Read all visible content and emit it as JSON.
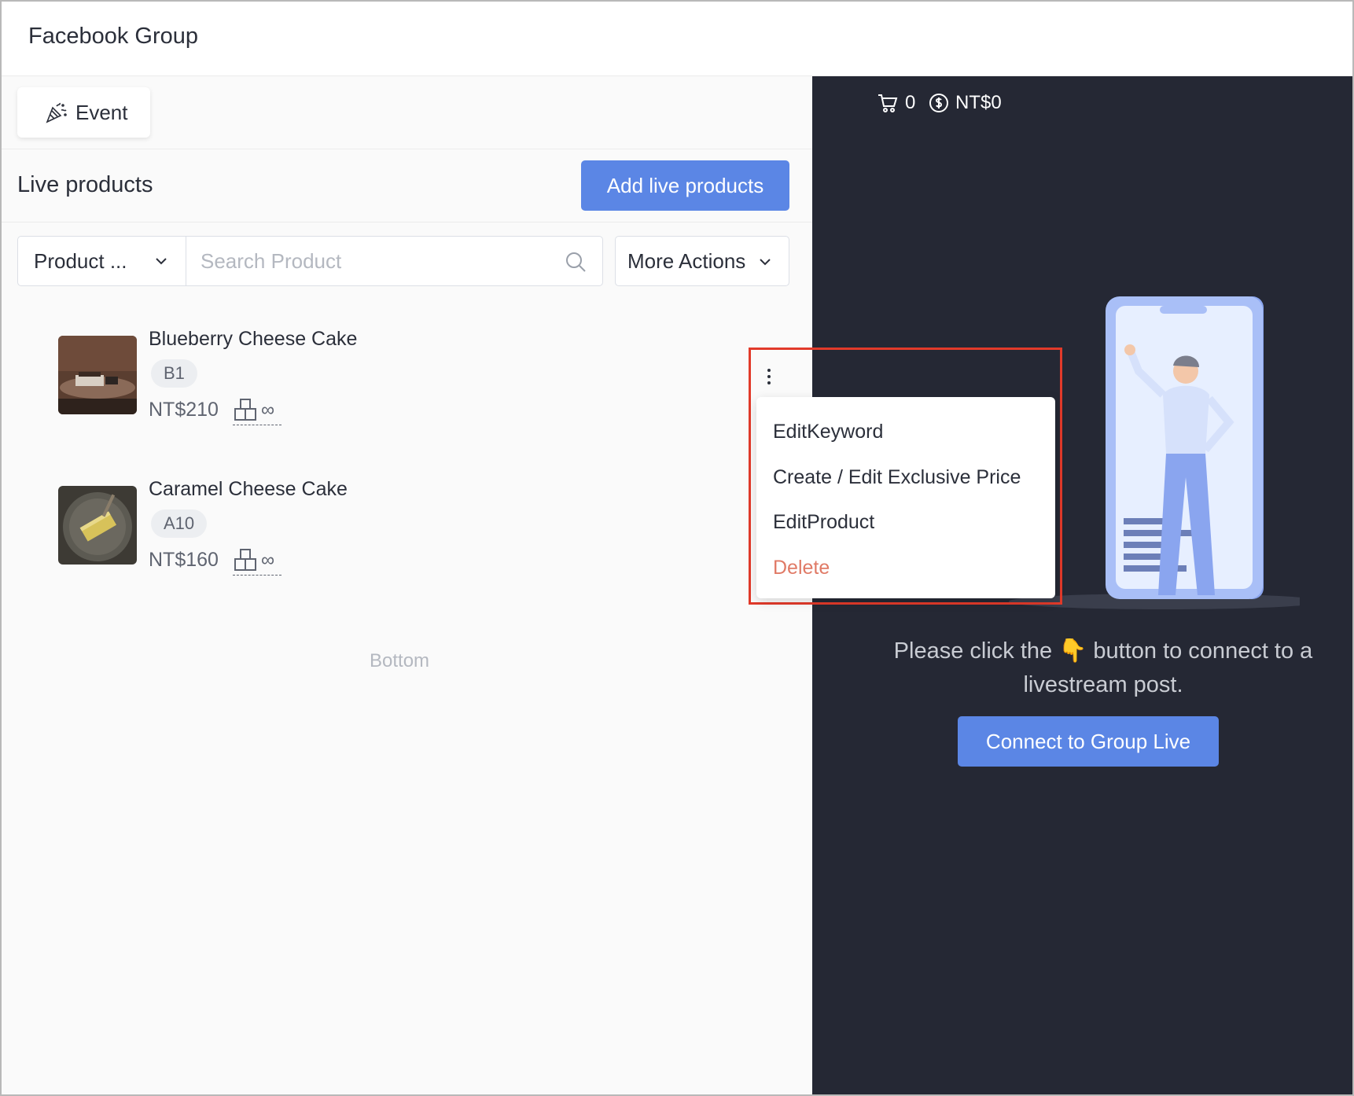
{
  "header": {
    "title": "Facebook Group"
  },
  "toolbar": {
    "event_label": "Event"
  },
  "live_products": {
    "title": "Live products",
    "add_label": "Add live products"
  },
  "filters": {
    "select_value": "Product ...",
    "search_placeholder": "Search Product",
    "more_actions_label": "More Actions"
  },
  "products": [
    {
      "name": "Blueberry Cheese Cake",
      "code": "B1",
      "price": "NT$210",
      "stock": "∞"
    },
    {
      "name": "Caramel Cheese Cake",
      "code": "A10",
      "price": "NT$160",
      "stock": "∞"
    }
  ],
  "list_end_text": "Bottom",
  "context_menu": {
    "items": [
      {
        "label": "EditKeyword"
      },
      {
        "label": "Create / Edit Exclusive Price"
      },
      {
        "label": "EditProduct"
      },
      {
        "label": "Delete"
      }
    ]
  },
  "stream": {
    "cart_count": "0",
    "total_amount": "NT$0",
    "hint_text": "Please click the 👇 button to connect to a livestream post.",
    "connect_label": "Connect to Group Live"
  },
  "colors": {
    "accent": "#5b86e5",
    "dark_panel": "#252834",
    "danger": "#e07a66",
    "highlight": "#e23a2a"
  },
  "icons": [
    "party-popper-icon",
    "chevron-down-icon",
    "search-icon",
    "stock-boxes-icon",
    "kebab-menu-icon",
    "cart-icon",
    "dollar-circle-icon"
  ]
}
